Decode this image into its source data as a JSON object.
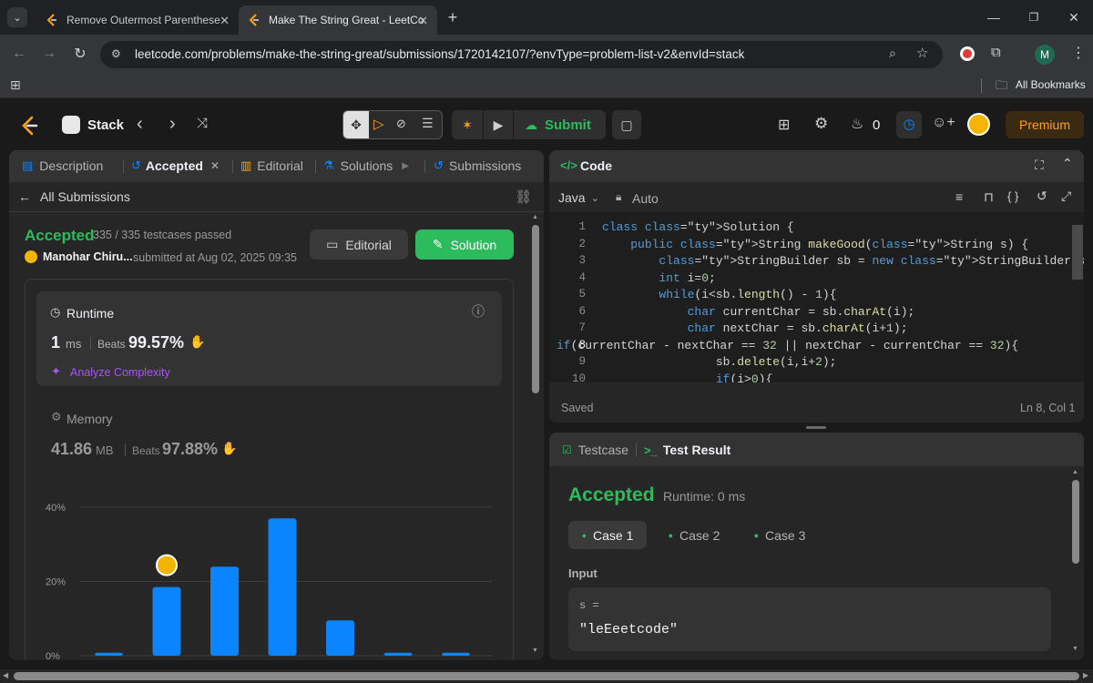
{
  "browser": {
    "tabs": [
      {
        "title": "Remove Outermost Parenthese",
        "active": false
      },
      {
        "title": "Make The String Great - LeetCo",
        "active": true
      }
    ],
    "url": "leetcode.com/problems/make-the-string-great/submissions/1720142107/?envType=problem-list-v2&envId=stack",
    "bookmarks_label": "All Bookmarks",
    "profile_initial": "M"
  },
  "nav": {
    "problem_list": "Stack",
    "submit_label": "Submit",
    "streak_count": "0",
    "premium_label": "Premium"
  },
  "left_tabs": [
    {
      "label": "Description"
    },
    {
      "label": "Accepted"
    },
    {
      "label": "Editorial"
    },
    {
      "label": "Solutions"
    },
    {
      "label": "Submissions"
    }
  ],
  "submission": {
    "back_label": "All Submissions",
    "status": "Accepted",
    "testcases": "335 / 335 testcases passed",
    "user": "Manohar Chiru...",
    "submitted_at": "submitted at Aug 02, 2025 09:35",
    "editorial_btn": "Editorial",
    "solution_btn": "Solution"
  },
  "runtime": {
    "title": "Runtime",
    "value": "1",
    "unit": "ms",
    "beats_label": "Beats",
    "beats": "99.57%",
    "analyze": "Analyze Complexity"
  },
  "memory": {
    "title": "Memory",
    "value": "41.86",
    "unit": "MB",
    "beats_label": "Beats",
    "beats": "97.88%"
  },
  "chart_data": {
    "type": "bar",
    "y_ticks": [
      "40%",
      "20%",
      "0%"
    ],
    "ylim": [
      0,
      40
    ],
    "values": [
      0.8,
      18.5,
      24,
      37,
      9.5,
      0.8,
      0.8
    ],
    "user_bar_index": 1,
    "bar_color": "#0a84ff"
  },
  "code_panel": {
    "title": "Code",
    "language": "Java",
    "autosave": "Auto",
    "status": "Saved",
    "cursor": "Ln 8, Col 1",
    "lines": [
      "class Solution {",
      "    public String makeGood(String s) {",
      "        StringBuilder sb = new StringBuilder(s);",
      "        int i=0;",
      "        while(i<sb.length() - 1){",
      "            char currentChar = sb.charAt(i);",
      "            char nextChar = sb.charAt(i+1);",
      "if(currentChar - nextChar == 32 || nextChar - currentChar == 32){",
      "                sb.delete(i,i+2);",
      "                if(i>0){"
    ],
    "line_numbers": [
      "1",
      "2",
      "3",
      "4",
      "5",
      "6",
      "7",
      "8",
      "9",
      "10"
    ]
  },
  "result_panel": {
    "tab_testcase": "Testcase",
    "tab_result": "Test Result",
    "status": "Accepted",
    "runtime": "Runtime: 0 ms",
    "cases": [
      "Case 1",
      "Case 2",
      "Case 3"
    ],
    "input_label": "Input",
    "var_label": "s =",
    "var_value": "\"leEeetcode\""
  }
}
